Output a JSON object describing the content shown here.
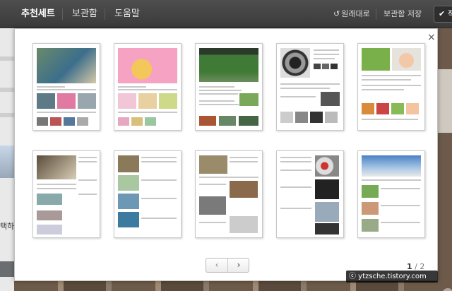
{
  "topbar": {
    "tabs": [
      {
        "label": "추천세트",
        "active": true
      },
      {
        "label": "보관함",
        "active": false
      },
      {
        "label": "도움말",
        "active": false
      }
    ],
    "revert_label": "원래대로",
    "save_label": "보관함 저장",
    "apply_label": "적"
  },
  "background": {
    "left_text": "택하시"
  },
  "modal": {
    "close_label": "×",
    "templates": [
      {
        "name": "template-1"
      },
      {
        "name": "template-2"
      },
      {
        "name": "template-3"
      },
      {
        "name": "template-4"
      },
      {
        "name": "template-5"
      },
      {
        "name": "template-6"
      },
      {
        "name": "template-7"
      },
      {
        "name": "template-8"
      },
      {
        "name": "template-9"
      },
      {
        "name": "template-10"
      }
    ],
    "pager": {
      "prev_label": "‹",
      "next_label": "›",
      "current_page": "1",
      "total_pages": "/ 2"
    }
  },
  "watermark": "ⓒ ytzsche.tistory.com",
  "colors": {
    "topbar": "#444444",
    "modal_bg": "#ffffff",
    "thumb_border": "#c9c9c9"
  }
}
